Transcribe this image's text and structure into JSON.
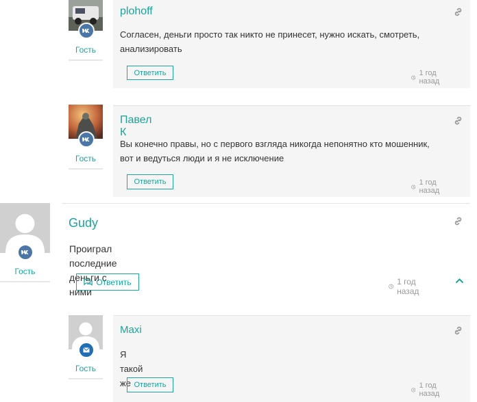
{
  "comments": [
    {
      "author": "plohoff",
      "text_lines": [
        "Согласен, деньги просто так никто не принесет, нужно искать, смотреть,",
        "анализировать"
      ],
      "user_role": "Гость",
      "reply_label": "Ответить",
      "time": "1 год назад",
      "social": "vk-icon"
    },
    {
      "author": "Павел К",
      "text_lines": [
        "Вы конечно правы, но с первого взгляда никогда непонятно кто мошенник,",
        "вот и ведуться люди и я не исключение"
      ],
      "user_role": "Гость",
      "reply_label": "Ответить",
      "time": "1 год назад",
      "social": "vk-icon"
    },
    {
      "author": "Gudy",
      "text_lines": [
        "Проиграл последние деньги с ними"
      ],
      "user_role": "Гость",
      "reply_label": "Ответить",
      "time": "1 год назад",
      "social": "vk-icon"
    },
    {
      "author": "Maxi",
      "text_lines": [
        "Я такой же"
      ],
      "user_role": "Гость",
      "reply_label": "Ответить",
      "time": "1 год назад",
      "social": "mail-icon"
    }
  ],
  "colors": {
    "accent": "#1ba39c",
    "vk": "#4a76a8",
    "mail": "#1e6fb5",
    "box_bg": "#f5f5f5"
  }
}
